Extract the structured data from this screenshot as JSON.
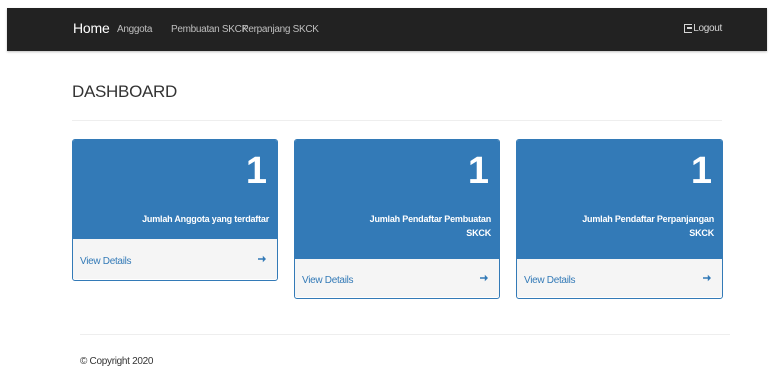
{
  "navbar": {
    "brand": "Home",
    "links": [
      "Anggota",
      "Pembuatan SKCK",
      "Perpanjang SKCK"
    ],
    "logout_label": "Logout",
    "background": "#222222"
  },
  "page": {
    "title": "DASHBOARD"
  },
  "panels": [
    {
      "count": "1",
      "label": "Jumlah Anggota yang terdaftar",
      "footer": "View Details"
    },
    {
      "count": "1",
      "label_lines": [
        "Jumlah Pendaftar Pembuatan",
        "SKCK"
      ],
      "footer": "View Details"
    },
    {
      "count": "1",
      "label_lines": [
        "Jumlah Pendaftar Perpanjangan",
        "SKCK"
      ],
      "footer": "View Details"
    }
  ],
  "colors": {
    "panel_primary": "#337ab7",
    "footer_bg": "#f5f5f5"
  },
  "icons": {
    "logout": "logout-icon",
    "arrow": "arrow-right-icon"
  },
  "footer": {
    "copyright": "© Copyright 2020"
  }
}
